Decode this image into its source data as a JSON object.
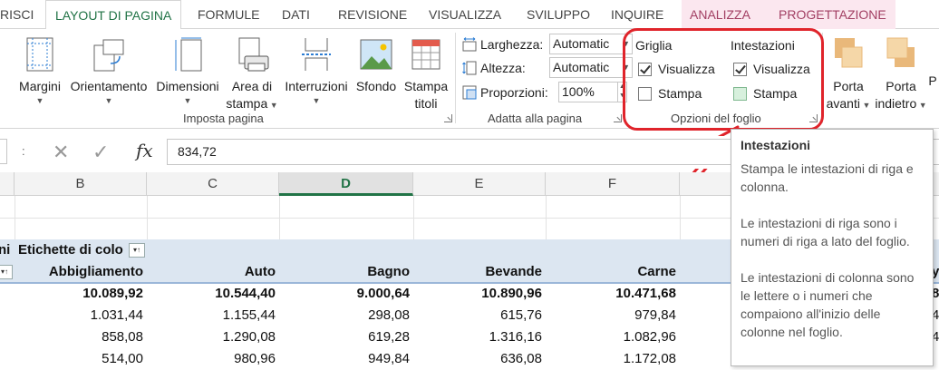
{
  "tabs": [
    {
      "label": "RISCI",
      "active": false
    },
    {
      "label": "LAYOUT DI PAGINA",
      "active": true
    },
    {
      "label": "FORMULE",
      "active": false
    },
    {
      "label": "DATI",
      "active": false
    },
    {
      "label": "REVISIONE",
      "active": false
    },
    {
      "label": "VISUALIZZA",
      "active": false
    },
    {
      "label": "SVILUPPO",
      "active": false
    },
    {
      "label": "INQUIRE",
      "active": false
    },
    {
      "label": "ANALIZZA",
      "active": false
    },
    {
      "label": "PROGETTAZIONE",
      "active": false
    }
  ],
  "ribbon": {
    "imposta_pagina": {
      "label": "Imposta pagina",
      "margini": "Margini",
      "orientamento": "Orientamento",
      "dimensioni": "Dimensioni",
      "area_line1": "Area di",
      "area_line2": "stampa",
      "interruzioni": "Interruzioni",
      "sfondo": "Sfondo",
      "stampa_line1": "Stampa",
      "stampa_line2": "titoli"
    },
    "adatta": {
      "label": "Adatta alla pagina",
      "larghezza_label": "Larghezza:",
      "larghezza_value": "Automatic",
      "altezza_label": "Altezza:",
      "altezza_value": "Automatic",
      "proporzioni_label": "Proporzioni:",
      "proporzioni_value": "100%"
    },
    "opzioni_foglio": {
      "label": "Opzioni del foglio",
      "griglia_title": "Griglia",
      "griglia_visualizza": "Visualizza",
      "griglia_stampa": "Stampa",
      "intestazioni_title": "Intestazioni",
      "intestazioni_visualizza": "Visualizza",
      "intestazioni_stampa": "Stampa"
    },
    "disponi": {
      "porta_avanti_line1": "Porta",
      "porta_avanti_line2": "avanti",
      "porta_indietro_line1": "Porta",
      "porta_indietro_line2": "indietro",
      "extra": "P"
    }
  },
  "formula_bar": {
    "separator": ":",
    "cancel": "✕",
    "enter": "✓",
    "fx": "fx",
    "value": "834,72"
  },
  "columns": [
    "B",
    "C",
    "D",
    "E",
    "F"
  ],
  "grid": {
    "pivot_header": {
      "left_fragment": "ni",
      "label": "Etichette di colo"
    },
    "headers": [
      "Abbigliamento",
      "Auto",
      "Bagno",
      "Bevande",
      "Carne"
    ],
    "extra_right": "y",
    "totals": [
      "10.089,92",
      "10.544,40",
      "9.000,64",
      "10.890,96",
      "10.471,68",
      "8"
    ],
    "rows": [
      [
        "1.031,44",
        "1.155,44",
        "298,08",
        "615,76",
        "979,84",
        "4"
      ],
      [
        "858,08",
        "1.290,08",
        "619,28",
        "1.316,16",
        "1.082,96",
        "4"
      ],
      [
        "514,00",
        "980,96",
        "949,84",
        "636,08",
        "1.172,08",
        ""
      ]
    ]
  },
  "tooltip": {
    "title": "Intestazioni",
    "p1": "Stampa le intestazioni di riga e colonna.",
    "p2": "Le intestazioni di riga sono i numeri di riga a lato del foglio.",
    "p3": "Le intestazioni di colonna sono le lettere o i numeri che compaiono all'inizio delle colonne nel foglio."
  },
  "colors": {
    "accent": "#217346",
    "callout": "#e0242b",
    "pivot_header_bg": "#dce6f1",
    "context_tab": "#a23f63"
  }
}
